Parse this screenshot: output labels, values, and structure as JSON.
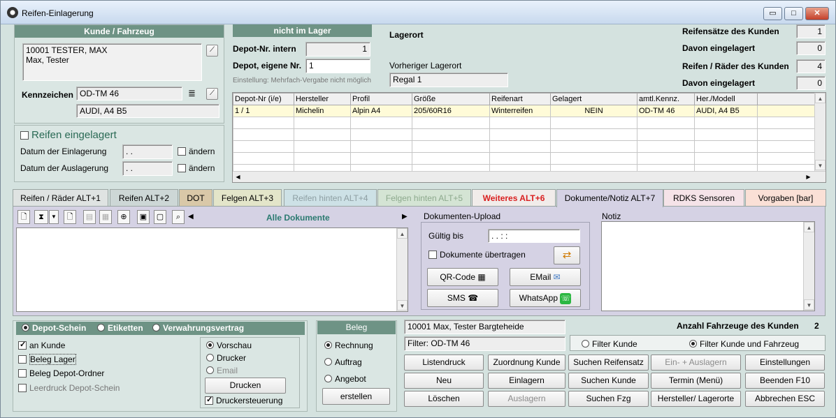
{
  "window": {
    "title": "Reifen-Einlagerung",
    "min": "▭",
    "max": "□",
    "close": "✕"
  },
  "customer": {
    "header": "Kunde / Fahrzeug",
    "line1": "10001 TESTER, MAX",
    "line2": "Max, Tester",
    "plate_label": "Kennzeichen",
    "plate": "OD-TM 46",
    "vehicle": "AUDI, A4 B5"
  },
  "stored": {
    "checkbox": "Reifen eingelagert",
    "date_in_label": "Datum der Einlagerung",
    "date_in": ". .",
    "date_out_label": "Datum der Auslagerung",
    "date_out": ". .",
    "change1": "ändern",
    "change2": "ändern"
  },
  "depot": {
    "header": "nicht im Lager",
    "intern_label": "Depot-Nr. intern",
    "intern": "1",
    "own_label": "Depot, eigene Nr.",
    "own": "1",
    "note": "Einstellung: Mehrfach-Vergabe nicht möglich",
    "location_label": "Lagerort",
    "prev_label": "Vorheriger Lagerort",
    "prev": "Regal 1"
  },
  "stats": {
    "sets_label": "Reifensätze des Kunden",
    "sets": "1",
    "sets_stored_label": "Davon eingelagert",
    "sets_stored": "0",
    "tires_label": "Reifen / Räder des Kunden",
    "tires": "4",
    "tires_stored_label": "Davon eingelagert",
    "tires_stored": "0"
  },
  "table": {
    "columns": [
      "Depot-Nr (i/e)",
      "Hersteller",
      "Profil",
      "Größe",
      "Reifenart",
      "Gelagert",
      "amtl.Kennz.",
      "Her./Modell"
    ],
    "rows": [
      [
        "1 / 1",
        "Michelin",
        "Alpin A4",
        "205/60R16",
        "Winterreifen",
        "NEIN",
        "OD-TM 46",
        "AUDI, A4 B5"
      ]
    ]
  },
  "tabs": [
    {
      "label": "Reifen / Räder ALT+1"
    },
    {
      "label": "Reifen ALT+2"
    },
    {
      "label": "DOT"
    },
    {
      "label": "Felgen ALT+3"
    },
    {
      "label": "Reifen hinten ALT+4"
    },
    {
      "label": "Felgen hinten ALT+5"
    },
    {
      "label": "Weiteres ALT+6"
    },
    {
      "label": "Dokumente/Notiz ALT+7"
    },
    {
      "label": "RDKS Sensoren"
    },
    {
      "label": "Vorgaben [bar]"
    }
  ],
  "docs": {
    "filter": "Alle Dokumente",
    "upload_label": "Dokumenten-Upload",
    "valid_label": "Gültig bis",
    "valid": ". .      : :",
    "transfer": "Dokumente übertragen",
    "qr": "QR-Code",
    "email": "EMail",
    "sms": "SMS",
    "whatsapp": "WhatsApp",
    "note_label": "Notiz"
  },
  "print": {
    "opt1": "Depot-Schein",
    "opt2": "Etiketten",
    "opt3": "Verwahrungsvertrag",
    "c1": "an Kunde",
    "c2": "Beleg Lager",
    "c3": "Beleg Depot-Ordner",
    "c4": "Leerdruck Depot-Schein",
    "r1": "Vorschau",
    "r2": "Drucker",
    "r3": "Email",
    "print_btn": "Drucken",
    "ctrl": "Druckersteuerung"
  },
  "beleg": {
    "header": "Beleg",
    "r1": "Rechnung",
    "r2": "Auftrag",
    "r3": "Angebot",
    "create": "erstellen"
  },
  "bottom": {
    "cust": "10001 Max, Tester Bargteheide",
    "filter": "Filter: OD-TM 46",
    "count_label": "Anzahl Fahrzeuge des Kunden",
    "count": "2",
    "f1": "Filter Kunde",
    "f2": "Filter Kunde und Fahrzeug",
    "buttons": [
      "Listendruck",
      "Zuordnung Kunde",
      "Suchen Reifensatz",
      "Ein- + Auslagern",
      "Einstellungen",
      "Neu",
      "Einlagern",
      "Suchen Kunde",
      "Termin (Menü)",
      "Beenden F10",
      "Löschen",
      "Auslagern",
      "Suchen Fzg",
      "Hersteller/ Lagerorte",
      "Abbrechen ESC"
    ]
  },
  "colors": {
    "header": "#6e9385",
    "window": "#d4e2df",
    "selrow": "#fffbd8",
    "warn": "#d91f1f"
  }
}
